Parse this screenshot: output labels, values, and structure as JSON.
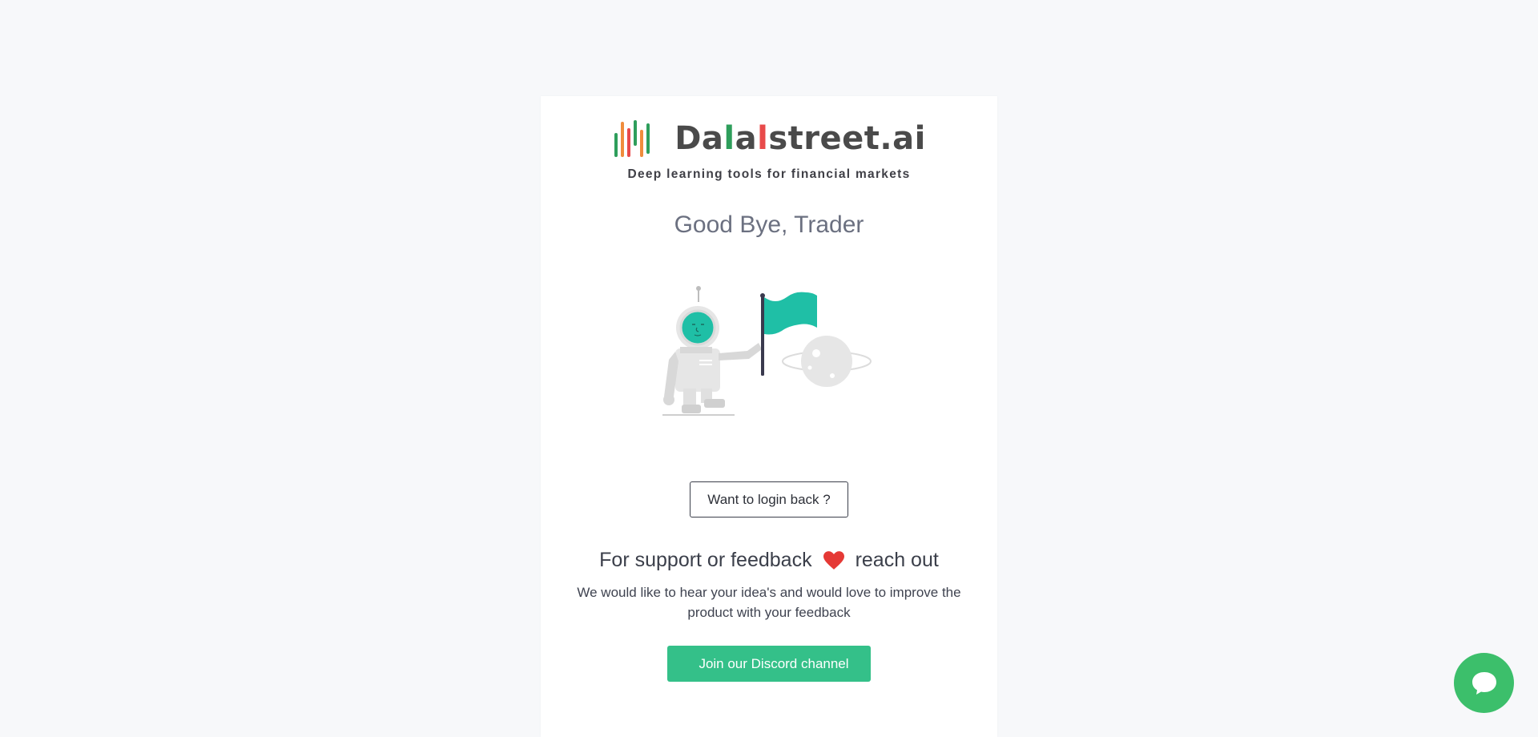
{
  "brand": {
    "name_parts": [
      "Da",
      "l",
      "a",
      "l",
      "street.ai"
    ],
    "tagline": "Deep learning tools for financial markets",
    "colors": {
      "text": "#4a4a4a",
      "l_first": "#2e9e5b",
      "l_second": "#e84a4a"
    },
    "logo_icon": "candlestick-bars-icon"
  },
  "main": {
    "heading": "Good Bye, Trader",
    "illustration_icon": "astronaut-flag-planet-illustration",
    "login_button": "Want to login back ?",
    "support": {
      "heading_before": "For support or feedback",
      "heading_icon": "heart-icon",
      "heading_after": "reach out",
      "text": "We would like to hear your idea's and would love to improve the product with your feedback"
    },
    "discord_button": "Join our Discord channel"
  },
  "chat_widget": {
    "icon": "chat-bubble-icon",
    "color": "#3cbf6b"
  },
  "colors": {
    "accent": "#34c089",
    "flag": "#1fbfa6",
    "heart": "#e53935"
  }
}
